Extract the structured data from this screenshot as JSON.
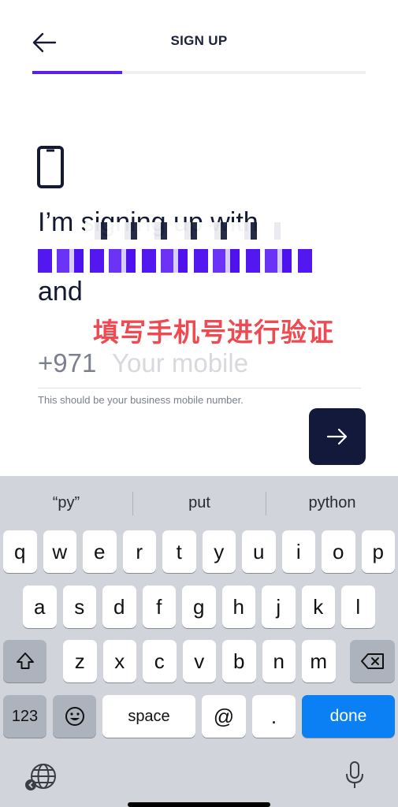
{
  "header": {
    "title": "SIGN UP",
    "back_icon": "arrow-left-icon"
  },
  "progress": {
    "fraction": 0.27,
    "fill_color": "#5a1fe8"
  },
  "content": {
    "line1": "I’m signing up with",
    "line3": "and",
    "overlay_note": "填写手机号进行验证"
  },
  "phone": {
    "country_code": "+971",
    "placeholder": "Your mobile",
    "value": "",
    "hint": "This should be your business mobile number."
  },
  "next_button": {
    "icon": "arrow-right-icon"
  },
  "keyboard": {
    "suggestions": [
      "“py”",
      "put",
      "python"
    ],
    "row1": [
      "q",
      "w",
      "e",
      "r",
      "t",
      "y",
      "u",
      "i",
      "o",
      "p"
    ],
    "row2": [
      "a",
      "s",
      "d",
      "f",
      "g",
      "h",
      "j",
      "k",
      "l"
    ],
    "row3": [
      "z",
      "x",
      "c",
      "v",
      "b",
      "n",
      "m"
    ],
    "numbers_label": "123",
    "space_label": "space",
    "at_label": "@",
    "dot_label": ".",
    "done_label": "done"
  }
}
